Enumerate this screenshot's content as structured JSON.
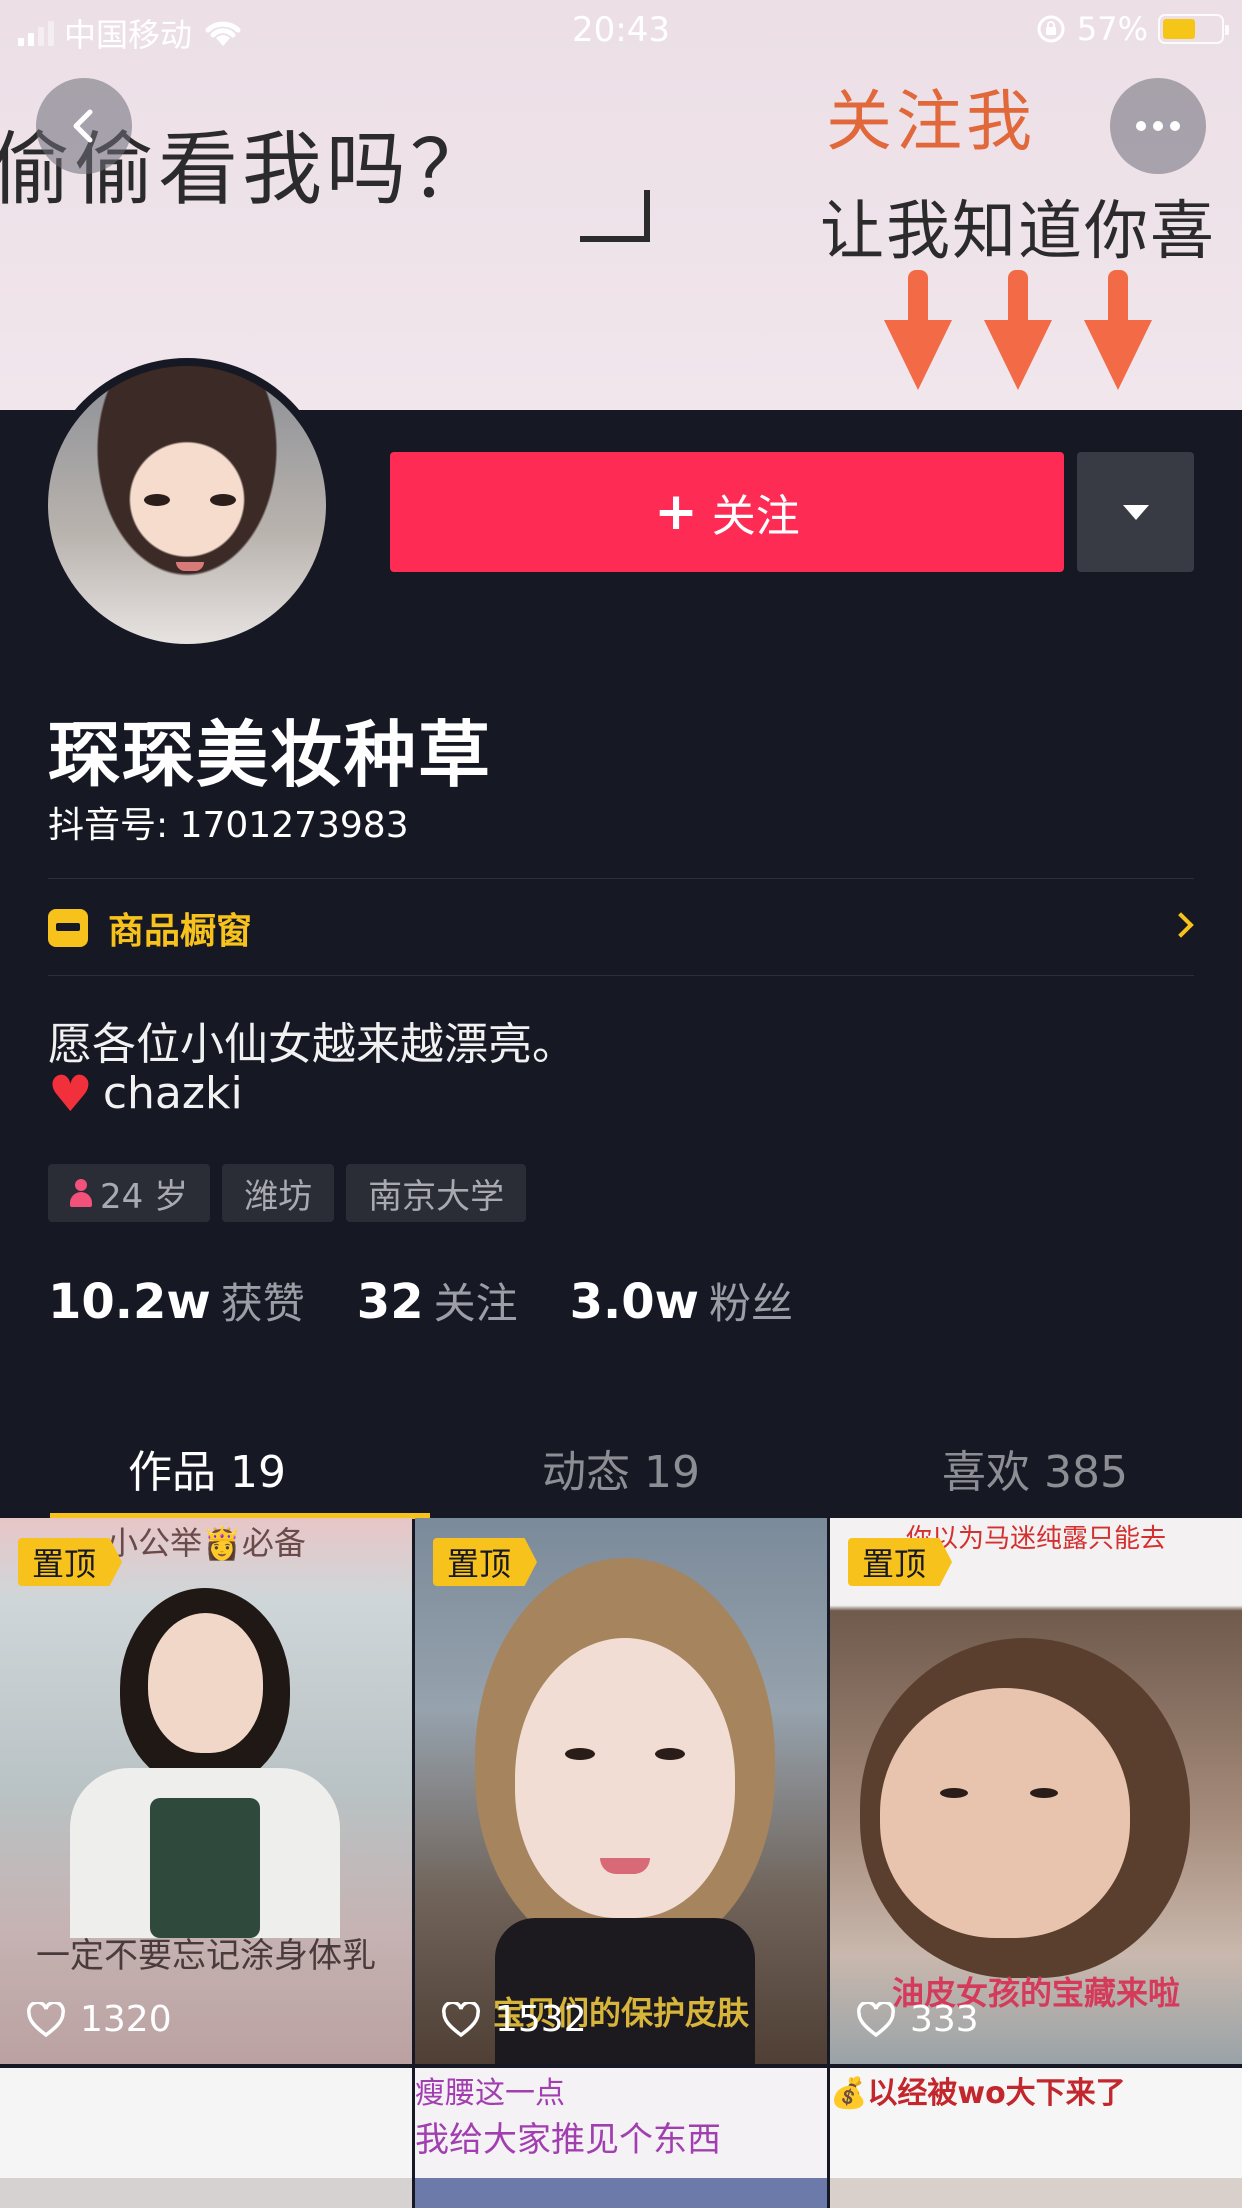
{
  "status_bar": {
    "carrier": "中国移动",
    "time": "20:43",
    "battery": "57%",
    "battery_level": 0.57
  },
  "banner": {
    "text_left": "偷偷看我吗？",
    "text_follow": "关注我",
    "text_sub": "让我知道你喜"
  },
  "profile": {
    "follow_label": "关注",
    "nickname": "琛琛美妆种草",
    "douyin_id": "抖音号: 1701273983",
    "shop_label": "商品橱窗",
    "bio_line1": "愿各位小仙女越来越漂亮。",
    "bio_line2": "chazki",
    "tags": {
      "age": "24 岁",
      "city": "潍坊",
      "school": "南京大学"
    },
    "stats": {
      "likes_num": "10.2w",
      "likes_label": "获赞",
      "following_num": "32",
      "following_label": "关注",
      "fans_num": "3.0w",
      "fans_label": "粉丝"
    }
  },
  "tabs": {
    "works": "作品 19",
    "moments": "动态 19",
    "likes": "喜欢 385"
  },
  "videos": [
    {
      "pin": "置顶",
      "likes": "1320",
      "caption_top": "小公举👸必备",
      "caption_bottom": "一定不要忘记涂身体乳"
    },
    {
      "pin": "置顶",
      "likes": "1532",
      "caption_top": "",
      "caption_bottom": "宝贝们的保护皮肤"
    },
    {
      "pin": "置顶",
      "likes": "333",
      "caption_top": "你以为马迷纯露只能去",
      "caption_bottom": "油皮女孩的宝藏来啦"
    }
  ],
  "videos_row2": [
    {
      "caption": ""
    },
    {
      "caption_top": "瘦腰这一点",
      "caption": "我给大家推见个东西"
    },
    {
      "caption": "💰以经被wo大下来了"
    }
  ],
  "colors": {
    "background": "#161823",
    "follow_red": "#fe2c55",
    "accent_yellow": "#f8c21c"
  }
}
